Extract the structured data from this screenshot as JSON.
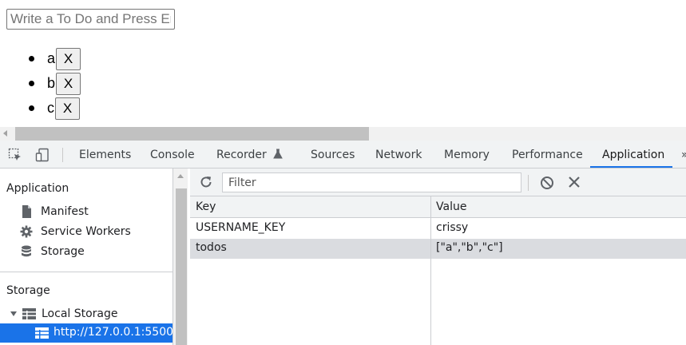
{
  "page": {
    "todo_placeholder": "Write a To Do and Press Enter",
    "todos": [
      {
        "text": "a",
        "delete_label": "X"
      },
      {
        "text": "b",
        "delete_label": "X"
      },
      {
        "text": "c",
        "delete_label": "X"
      }
    ]
  },
  "devtools": {
    "tabs": [
      "Elements",
      "Console",
      "Recorder",
      "Sources",
      "Network",
      "Memory",
      "Performance",
      "Application"
    ],
    "active_tab": "Application",
    "overflow_label": "»",
    "sidebar": {
      "application_heading": "Application",
      "application_items": [
        {
          "label": "Manifest",
          "icon": "file-icon"
        },
        {
          "label": "Service Workers",
          "icon": "gear-icon"
        },
        {
          "label": "Storage",
          "icon": "database-icon"
        }
      ],
      "storage_heading": "Storage",
      "local_storage_label": "Local Storage",
      "selected_origin": "http://127.0.0.1:5500"
    },
    "toolbar": {
      "filter_placeholder": "Filter"
    },
    "table": {
      "columns": [
        "Key",
        "Value"
      ],
      "rows": [
        {
          "key": "USERNAME_KEY",
          "value": "crissy"
        },
        {
          "key": "todos",
          "value": "[\"a\",\"b\",\"c\"]"
        }
      ],
      "selected_row": 1
    },
    "colors": {
      "accent": "#1a73e8",
      "toolbar_bg": "#f1f3f4",
      "selected_row_bg": "#dadce0"
    }
  }
}
